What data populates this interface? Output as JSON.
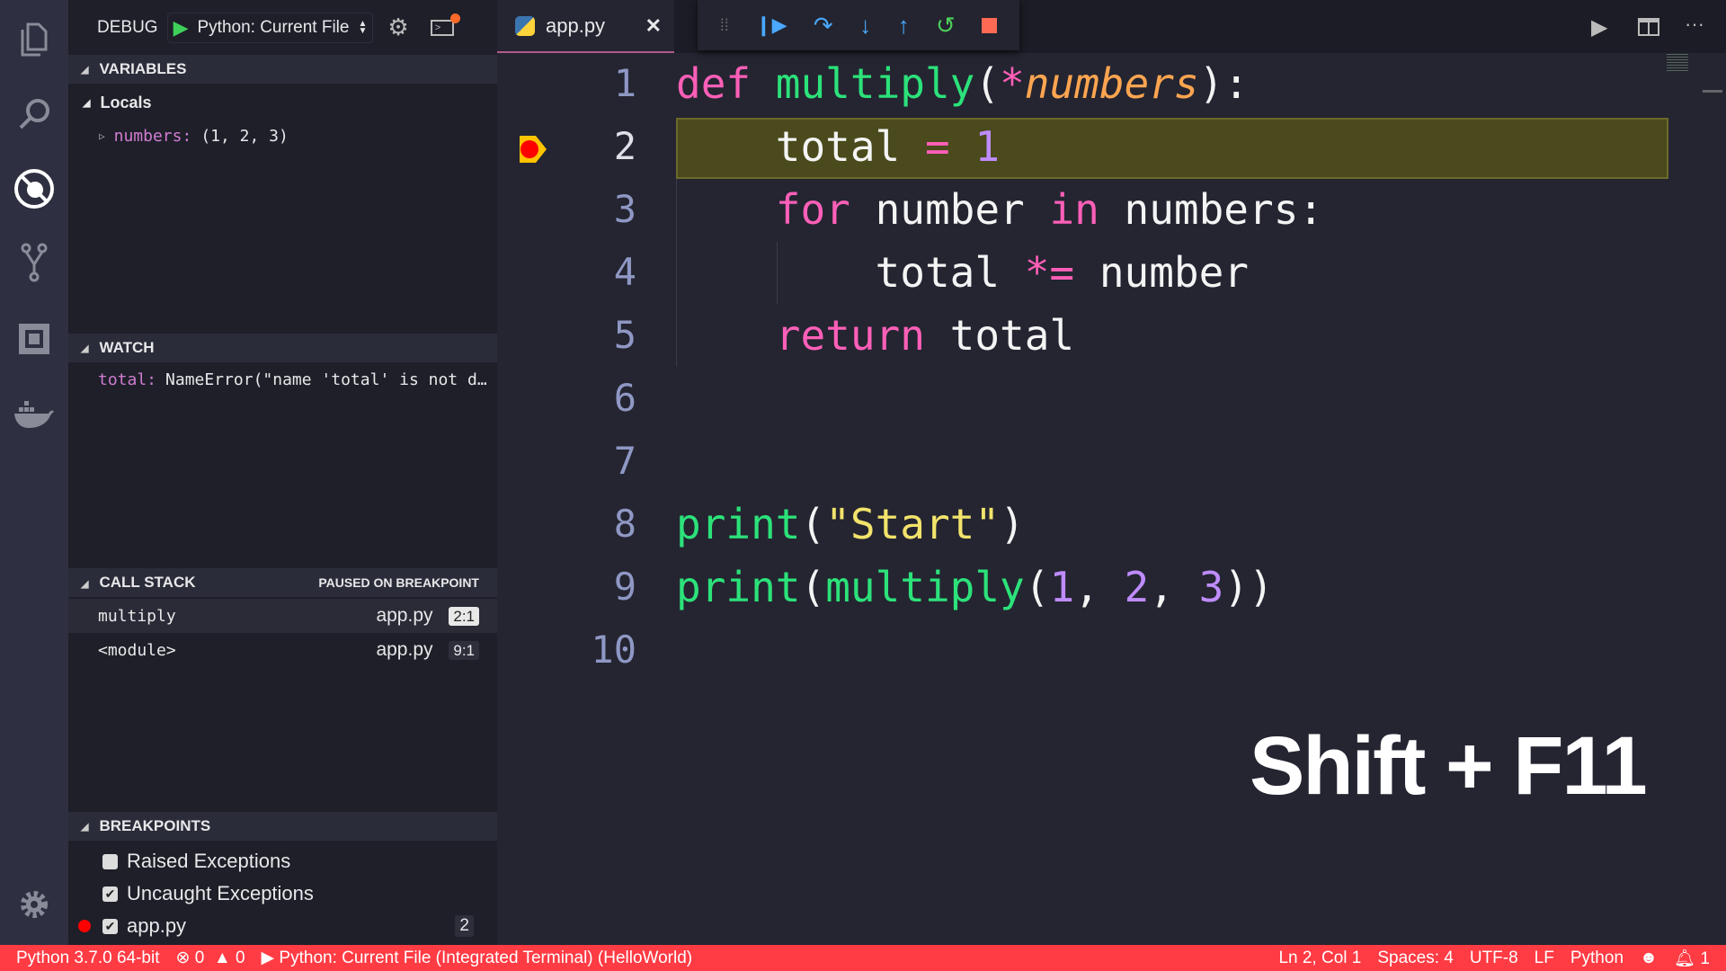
{
  "activity": [
    "explorer-icon",
    "search-icon",
    "debug-icon",
    "source-control-icon",
    "extensions-icon",
    "docker-icon",
    "settings-gear-icon"
  ],
  "debug": {
    "title": "DEBUG",
    "config": "Python: Current File"
  },
  "variables": {
    "header": "VARIABLES",
    "scope": "Locals",
    "items": [
      {
        "name": "numbers:",
        "value": "(1, 2, 3)"
      }
    ]
  },
  "watch": {
    "header": "WATCH",
    "items": [
      {
        "name": "total:",
        "value": "NameError(\"name 'total' is not d…"
      }
    ]
  },
  "callstack": {
    "header": "CALL STACK",
    "status": "PAUSED ON BREAKPOINT",
    "frames": [
      {
        "name": "multiply",
        "file": "app.py",
        "pos": "2:1"
      },
      {
        "name": "<module>",
        "file": "app.py",
        "pos": "9:1"
      }
    ]
  },
  "breakpoints": {
    "header": "BREAKPOINTS",
    "items": [
      {
        "label": "Raised Exceptions",
        "checked": false
      },
      {
        "label": "Uncaught Exceptions",
        "checked": true
      },
      {
        "label": "app.py",
        "checked": true,
        "line": "2"
      }
    ]
  },
  "tab": {
    "label": "app.py"
  },
  "editor": {
    "line_numbers": [
      "1",
      "2",
      "3",
      "4",
      "5",
      "6",
      "7",
      "8",
      "9",
      "10"
    ],
    "current_line": 2
  },
  "overlay": "Shift + F11",
  "status": {
    "interpreter": "Python 3.7.0 64-bit",
    "errors": "0",
    "warnings": "0",
    "launch": "Python: Current File (Integrated Terminal) (HelloWorld)",
    "position": "Ln 2, Col 1",
    "spaces": "Spaces: 4",
    "encoding": "UTF-8",
    "eol": "LF",
    "language": "Python",
    "notifications": "1"
  },
  "colors": {
    "status_bar": "#ff3b44",
    "highlight": "#4a4a1c",
    "keyword": "#ff5fb8",
    "function": "#2ce27a"
  }
}
